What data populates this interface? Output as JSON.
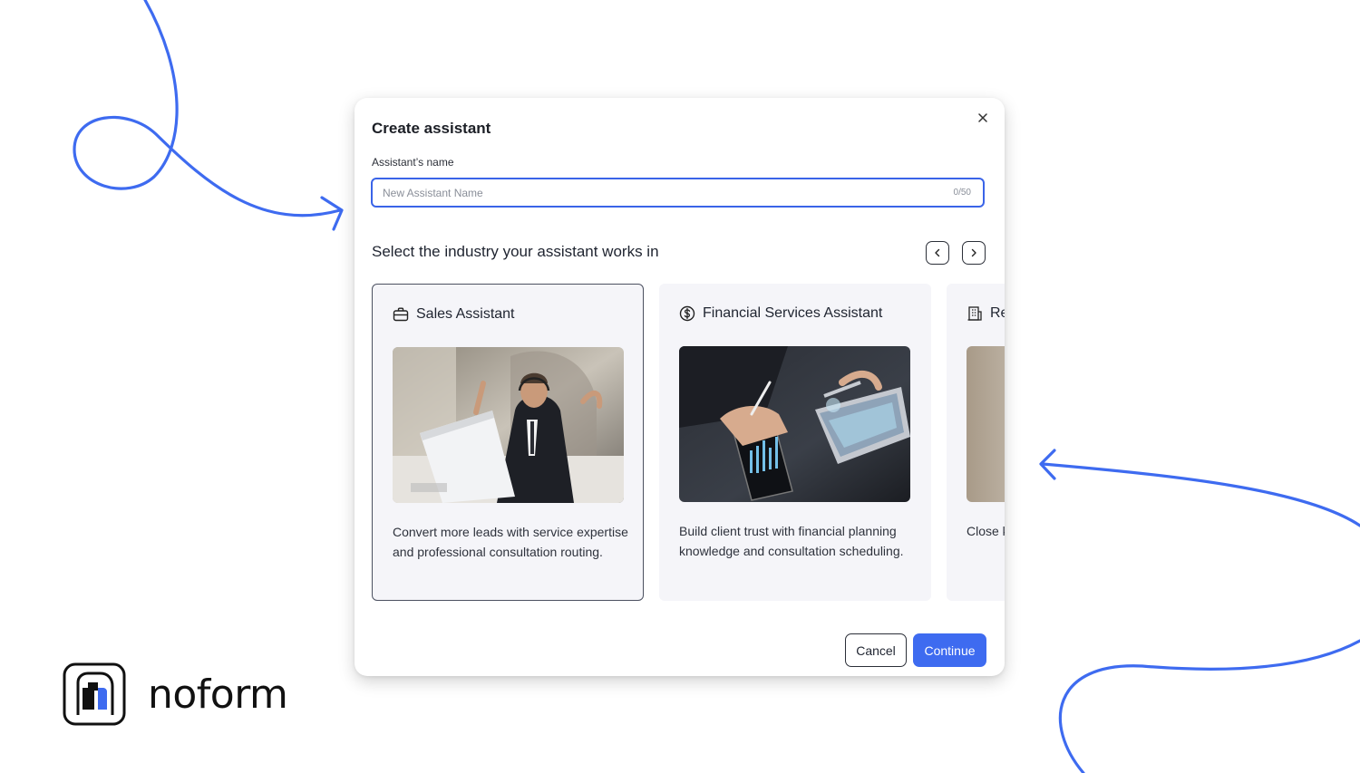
{
  "brand": {
    "name": "noform",
    "accent": "#3e6bf0"
  },
  "dialog": {
    "title": "Create assistant",
    "close_icon": "close-icon",
    "name_field": {
      "label": "Assistant’s name",
      "placeholder": "New Assistant Name",
      "value": "",
      "counter": "0/50"
    },
    "industry": {
      "heading": "Select the industry your assistant works in",
      "prev_icon": "chevron-left-icon",
      "next_icon": "chevron-right-icon",
      "cards": [
        {
          "title": "Sales Assistant",
          "icon": "briefcase-icon",
          "image": "man-with-headset-at-laptop-photo",
          "description": "Convert more leads with service expertise and professional consultation routing.",
          "selected": true
        },
        {
          "title": "Financial Services Assistant",
          "icon": "dollar-circle-icon",
          "image": "hands-with-phone-chart-photo",
          "description": "Build client trust with financial planning knowledge and consultation scheduling.",
          "selected": false
        },
        {
          "title": "Re",
          "icon": "building-icon",
          "image": "blurred-photo",
          "description": "Close knowl",
          "selected": false
        }
      ]
    },
    "actions": {
      "cancel": "Cancel",
      "continue": "Continue"
    }
  }
}
